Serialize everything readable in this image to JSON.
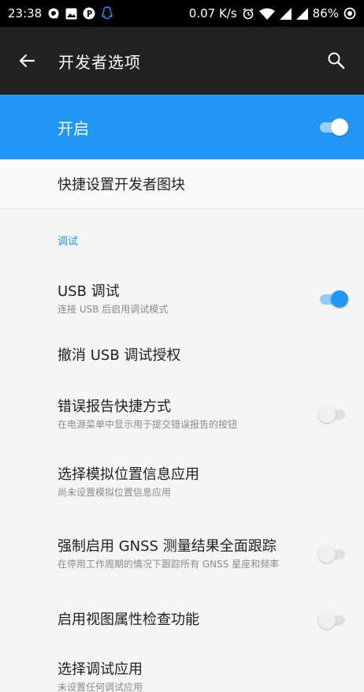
{
  "status_bar": {
    "time": "23:38",
    "net_speed": "0.07 K/s",
    "battery": "86%",
    "left_icons": [
      "q-app-icon",
      "image-icon",
      "p-app-icon",
      "qq-penguin-icon"
    ],
    "right_icons": [
      "alarm-icon",
      "wifi-icon",
      "signal-icon",
      "signal-icon",
      "battery-saver-icon"
    ]
  },
  "app_bar": {
    "title": "开发者选项",
    "back_icon": "arrow-back-icon",
    "search_icon": "search-icon"
  },
  "master_switch": {
    "label": "开启",
    "checked": true
  },
  "tiles_row": {
    "label": "快捷设置开发者图块"
  },
  "section": {
    "header": "调试"
  },
  "prefs": [
    {
      "title": "USB 调试",
      "summary": "连接 USB 后启用调试模式",
      "toggle": "on"
    },
    {
      "title": "撤消 USB 调试授权",
      "summary": "",
      "toggle": "none"
    },
    {
      "title": "错误报告快捷方式",
      "summary": "在电源菜单中显示用于提交错误报告的按钮",
      "toggle": "off"
    },
    {
      "title": "选择模拟位置信息应用",
      "summary": "尚未设置模拟位置信息应用",
      "toggle": "none"
    },
    {
      "title": "强制启用 GNSS 测量结果全面跟踪",
      "summary": "在停用工作周期的情况下跟踪所有 GNSS 星座和频率",
      "toggle": "off"
    },
    {
      "title": "启用视图属性检查功能",
      "summary": "",
      "toggle": "off"
    },
    {
      "title": "选择调试应用",
      "summary": "未设置任何调试应用",
      "toggle": "none"
    }
  ],
  "colors": {
    "accent": "#2196f3",
    "app_bar": "#212121",
    "status_bar": "#000000",
    "background": "#f5f5f5"
  }
}
